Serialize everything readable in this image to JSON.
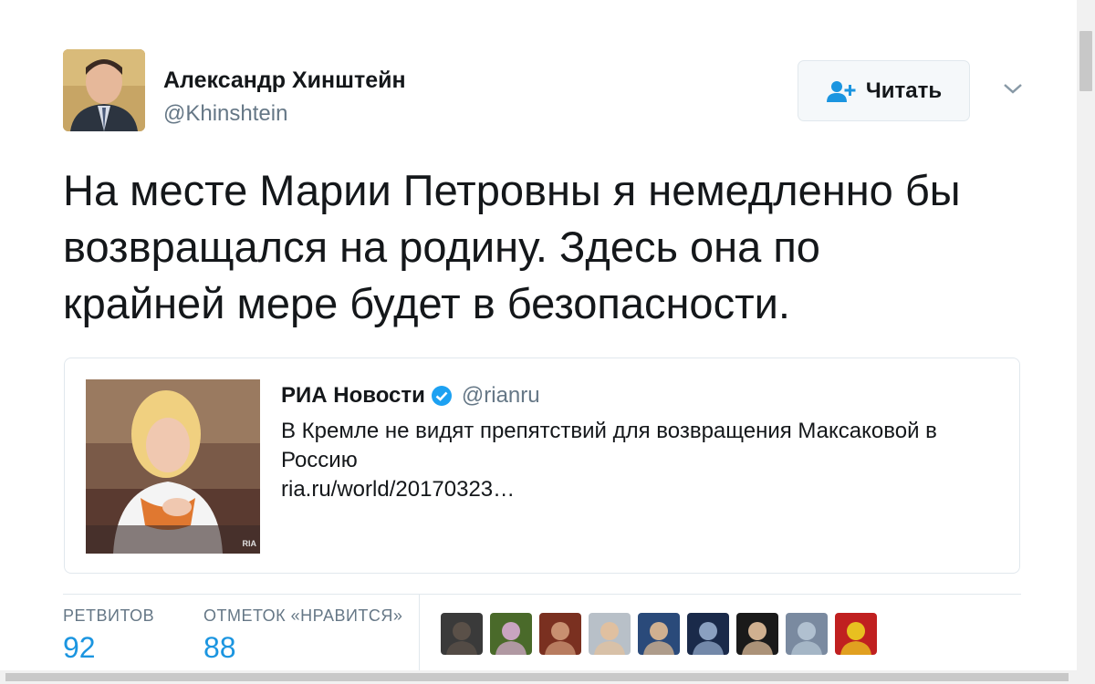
{
  "author": {
    "name": "Александр Хинштейн",
    "handle": "@Khinshtein"
  },
  "follow_button": {
    "label": "Читать",
    "icon": "follow-user-plus-icon"
  },
  "menu_caret_icon": "chevron-down-icon",
  "tweet_text": "На месте Марии Петровны я немедленно бы\nвозвращался на родину. Здесь она по\nкрайней мере будет в безопасности.",
  "quoted": {
    "name": "РИА Новости",
    "verified_icon": "verified-badge-icon",
    "handle": "@rianru",
    "text": "В Кремле не видят препятствий для возвращения Максаковой в Россию",
    "link": "ria.ru/world/20170323…",
    "image_watermark": "RIA"
  },
  "stats": {
    "retweets_label": "РЕТВИТОВ",
    "retweets_value": "92",
    "likes_label": "ОТМЕТОК «НРАВИТСЯ»",
    "likes_value": "88"
  },
  "likers": [
    {
      "colors": [
        "#3a3a3a",
        "#5a5048"
      ]
    },
    {
      "colors": [
        "#4a6a2a",
        "#c9a4c0"
      ]
    },
    {
      "colors": [
        "#7a3020",
        "#c89070"
      ]
    },
    {
      "colors": [
        "#b8c0c8",
        "#e0c0a0"
      ]
    },
    {
      "colors": [
        "#2a4a7a",
        "#d0b090"
      ]
    },
    {
      "colors": [
        "#1a2a4a",
        "#8aa0c0"
      ]
    },
    {
      "colors": [
        "#1a1a1a",
        "#d0b090"
      ]
    },
    {
      "colors": [
        "#7a8aa0",
        "#b0c0d0"
      ]
    },
    {
      "colors": [
        "#c02020",
        "#e8c020"
      ]
    }
  ],
  "colors": {
    "accent": "#1b95e0",
    "text": "#14171a",
    "muted": "#657786",
    "border": "#e1e8ed"
  }
}
